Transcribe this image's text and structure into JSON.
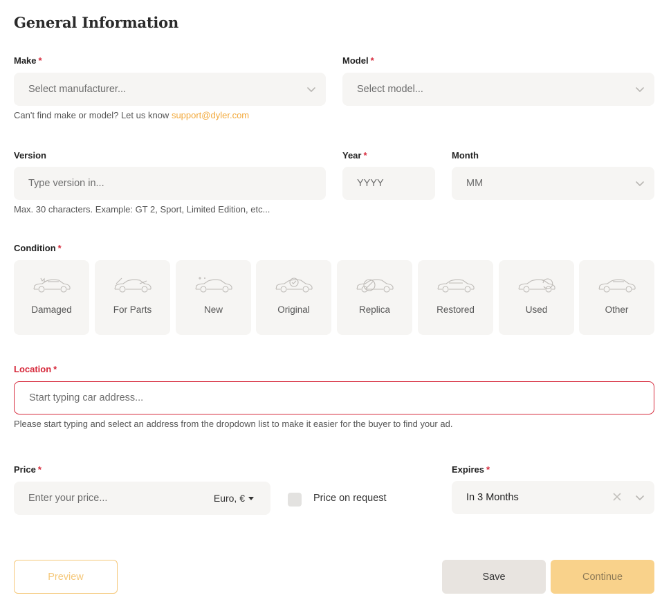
{
  "page": {
    "title": "General Information"
  },
  "make": {
    "label": "Make",
    "required": "*",
    "placeholder": "Select manufacturer..."
  },
  "model": {
    "label": "Model",
    "required": "*",
    "placeholder": "Select model..."
  },
  "make_hint": {
    "text": "Can't find make or model? Let us know ",
    "email": "support@dyler.com"
  },
  "version": {
    "label": "Version",
    "placeholder": "Type version in...",
    "hint": "Max. 30 characters. Example: GT 2, Sport, Limited Edition, etc..."
  },
  "year": {
    "label": "Year",
    "required": "*",
    "placeholder": "YYYY"
  },
  "month": {
    "label": "Month",
    "placeholder": "MM"
  },
  "condition": {
    "label": "Condition",
    "required": "*",
    "options": [
      {
        "label": "Damaged",
        "icon": "car-damaged-icon"
      },
      {
        "label": "For Parts",
        "icon": "car-for-parts-icon"
      },
      {
        "label": "New",
        "icon": "car-new-icon"
      },
      {
        "label": "Original",
        "icon": "car-original-icon"
      },
      {
        "label": "Replica",
        "icon": "car-replica-icon"
      },
      {
        "label": "Restored",
        "icon": "car-restored-icon"
      },
      {
        "label": "Used",
        "icon": "car-used-icon"
      },
      {
        "label": "Other",
        "icon": "car-other-icon"
      }
    ]
  },
  "location": {
    "label": "Location",
    "required": "*",
    "placeholder": "Start typing car address...",
    "hint": "Please start typing and select an address from the dropdown list to make it easier for the buyer to find your ad."
  },
  "price": {
    "label": "Price",
    "required": "*",
    "placeholder": "Enter your price...",
    "currency": "Euro, €"
  },
  "price_on_request": {
    "label": "Price on request"
  },
  "expires": {
    "label": "Expires",
    "required": "*",
    "value": "In 3 Months"
  },
  "buttons": {
    "preview": "Preview",
    "save": "Save",
    "continue": "Continue"
  },
  "colors": {
    "accent": "#f2a93b",
    "error": "#d6283a",
    "field_bg": "#f6f5f3"
  }
}
